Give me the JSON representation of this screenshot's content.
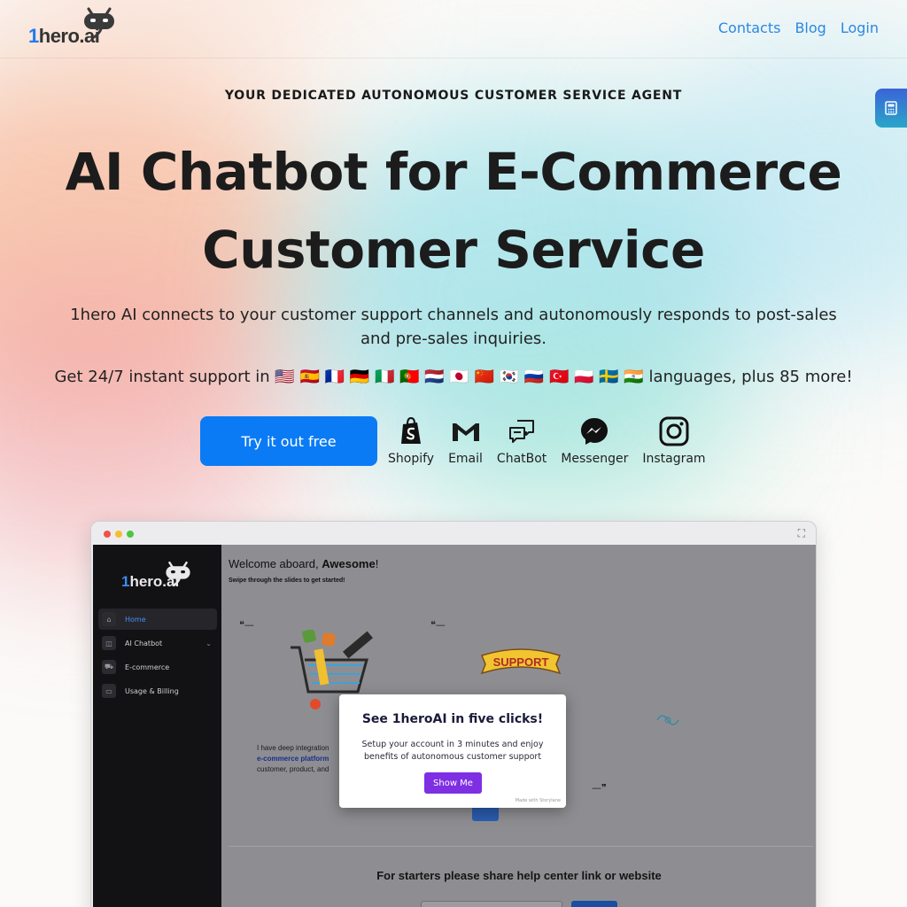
{
  "brand": {
    "logo_text_one": "1",
    "logo_text_rest": "hero.ai"
  },
  "nav": {
    "items": [
      "Contacts",
      "Blog",
      "Login"
    ]
  },
  "hero": {
    "eyebrow": "YOUR DEDICATED AUTONOMOUS CUSTOMER SERVICE AGENT",
    "headline_line1": "AI Chatbot for E-Commerce",
    "headline_line2": "Customer Service",
    "subtitle": "1hero AI connects to your customer support channels and autonomously responds to post-sales and pre-sales inquiries.",
    "languages_prefix": "Get 24/7 instant support in",
    "language_flags": [
      "🇺🇸",
      "🇪🇸",
      "🇫🇷",
      "🇩🇪",
      "🇮🇹",
      "🇵🇹",
      "🇳🇱",
      "🇯🇵",
      "🇨🇳",
      "🇰🇷",
      "🇷🇺",
      "🇹🇷",
      "🇵🇱",
      "🇸🇪",
      "🇮🇳"
    ],
    "languages_suffix": "languages, plus 85 more!",
    "cta_label": "Try it out free"
  },
  "channels": [
    {
      "label": "Shopify",
      "icon": "shopify-icon"
    },
    {
      "label": "Email",
      "icon": "gmail-icon"
    },
    {
      "label": "ChatBot",
      "icon": "chat-bubbles-icon"
    },
    {
      "label": "Messenger",
      "icon": "messenger-icon"
    },
    {
      "label": "Instagram",
      "icon": "instagram-icon"
    }
  ],
  "preview": {
    "sidebar": {
      "logo_one": "1",
      "logo_rest": "hero.ai",
      "items": [
        {
          "label": "Home",
          "icon": "home-icon",
          "active": true
        },
        {
          "label": "AI Chatbot",
          "icon": "bot-icon",
          "active": false
        },
        {
          "label": "E-commerce",
          "icon": "cart-icon",
          "active": false
        },
        {
          "label": "Usage & Billing",
          "icon": "wallet-icon",
          "active": false
        }
      ]
    },
    "welcome_prefix": "Welcome aboard, ",
    "welcome_name": "Awesome",
    "welcome_suffix": "!",
    "swipe_hint": "Swipe through the slides to get started!",
    "slide_line1": "I have deep integration",
    "slide_line2_hl": "e-commerce platform",
    "slide_line3": "customer, product, and",
    "support_banner": "SUPPORT",
    "starters_heading": "For starters please share help center link or website",
    "modal": {
      "title": "See 1heroAI in five clicks!",
      "body": "Setup your account in 3 minutes and enjoy benefits of autonomous customer support",
      "button": "Show Me",
      "credit": "Made with Storylane"
    }
  },
  "colors": {
    "accent": "#0a7bf5",
    "nav_link": "#2b88e0",
    "modal_button": "#7e2fe3",
    "side_tab_start": "#3b64d8",
    "side_tab_end": "#2aa6c9"
  }
}
